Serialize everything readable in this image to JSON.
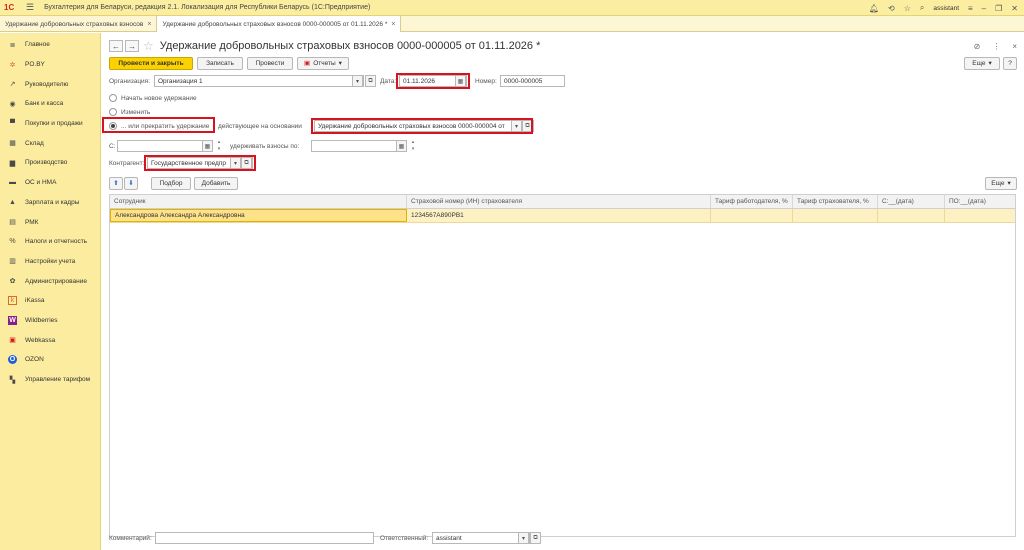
{
  "app": {
    "title": "Бухгалтерия для Беларуси, редакция 2.1. Локализация для Республики Беларусь  (1С:Предприятие)",
    "logo": "1С",
    "user": "assistant"
  },
  "tabs": [
    {
      "label": "Удержание добровольных страховых взносов",
      "close": "×"
    },
    {
      "label": "Удержание добровольных страховых взносов 0000-000005 от 01.11.2026 *",
      "close": "×"
    }
  ],
  "sidebar": {
    "items": [
      {
        "label": "Главное",
        "icon": "≣"
      },
      {
        "label": "PO.BY",
        "icon": "✲"
      },
      {
        "label": "Руководителю",
        "icon": "↗"
      },
      {
        "label": "Банк и касса",
        "icon": "◉"
      },
      {
        "label": "Покупки и продажи",
        "icon": "▀"
      },
      {
        "label": "Склад",
        "icon": "▦"
      },
      {
        "label": "Производство",
        "icon": "▆"
      },
      {
        "label": "ОС и НМА",
        "icon": "▬"
      },
      {
        "label": "Зарплата и кадры",
        "icon": "▲"
      },
      {
        "label": "РМК",
        "icon": "▤"
      },
      {
        "label": "Налоги и отчетность",
        "icon": "%"
      },
      {
        "label": "Настройки учета",
        "icon": "▥"
      },
      {
        "label": "Администрирование",
        "icon": "✿"
      },
      {
        "label": "iKassa",
        "icon": "k"
      },
      {
        "label": "Wildberries",
        "icon": "W"
      },
      {
        "label": "Webkassa",
        "icon": "▣"
      },
      {
        "label": "OZON",
        "icon": "O"
      },
      {
        "label": "Управление тарифом",
        "icon": "▚"
      }
    ]
  },
  "doc": {
    "back": "←",
    "forward": "→",
    "title": "Удержание добровольных страховых взносов 0000-000005 от 01.11.2026 *",
    "star": "☆",
    "link_icon": "⊘",
    "more": "⋮",
    "close": "×"
  },
  "toolbar": {
    "post_close": "Провести и закрыть",
    "save": "Записать",
    "post": "Провести",
    "reports": "Отчеты",
    "more": "Еще"
  },
  "form": {
    "org_label": "Организация:",
    "org_value": "Организация 1",
    "date_label": "Дата:",
    "date_value": "01.11.2026",
    "number_label": "Номер:",
    "number_value": "0000-000005",
    "radio_new": "Начать новое удержание",
    "radio_change": "Изменить",
    "radio_stop": "... или прекратить удержание",
    "basis_label": "действующее на основании",
    "basis_value": "Удержание добровольных страховых взносов 0000-000004 от",
    "from_label": "С:",
    "from_value": "",
    "until_label": "удерживать взносы по:",
    "until_value": "",
    "contractor_label": "Контрагент:",
    "contractor_value": "Государственное предпр"
  },
  "table_toolbar": {
    "up": "⬆",
    "down": "⬇",
    "select": "Подбор",
    "add": "Добавить",
    "more": "Еще"
  },
  "table": {
    "columns": [
      "Сотрудник",
      "Страховой номер (ИН) страхователя",
      "Тариф работодателя, %",
      "Тариф страхователя, %",
      "С:__(дата)",
      "ПО:__(дата)"
    ],
    "rows": [
      [
        "Александрова Александра Александровна",
        "1234567A890PB1",
        "",
        "",
        "",
        ""
      ]
    ]
  },
  "footer": {
    "comment_label": "Комментарий:",
    "comment_value": "",
    "responsible_label": "Ответственный:",
    "responsible_value": "assistant"
  },
  "colors": {
    "accent": "#fbd200",
    "highlight": "#d9121f",
    "sidebar": "#fbeca0"
  }
}
